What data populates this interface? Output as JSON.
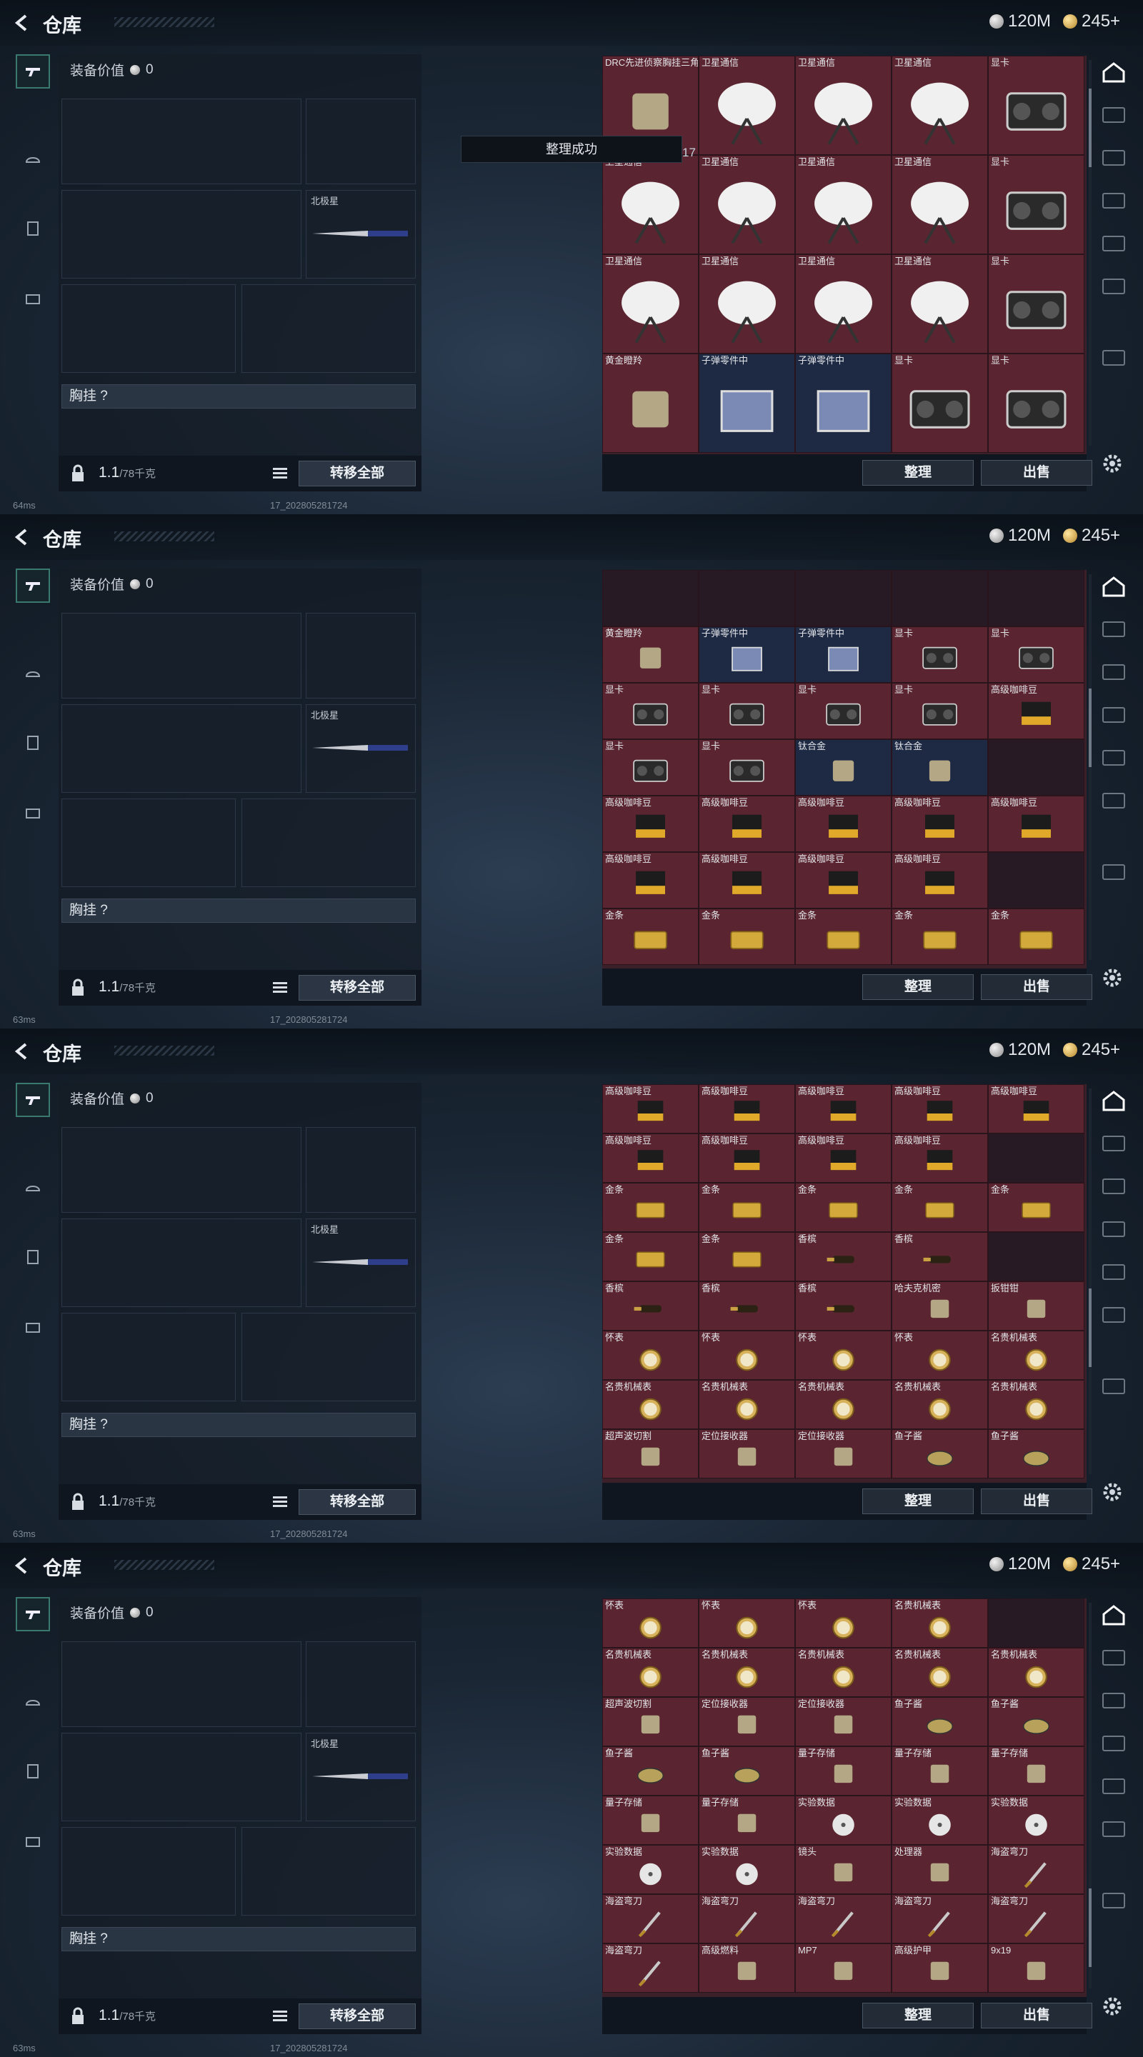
{
  "header": {
    "title": "仓库",
    "silver": "120M",
    "gold": "245+"
  },
  "loadout": {
    "equipment_value_label": "装备价值",
    "equipment_value": "0",
    "melee_label": "北极星",
    "chest_rig_label": "胸挂 ?",
    "weight": "1.1",
    "weight_max": "/78千克",
    "transfer_all": "转移全部"
  },
  "stash": {
    "sort_button": "整理",
    "sell_button": "出售"
  },
  "toast": {
    "message": "整理成功",
    "count": "17"
  },
  "panels": [
    {
      "ping": "64ms",
      "build": "17_2028052817​24",
      "rows": [
        [
          "DRC先进侦察胸挂三角洲",
          "卫星通信",
          "卫星通信",
          "卫星通信",
          "显卡"
        ],
        [
          "卫星通信",
          "卫星通信",
          "卫星通信",
          "卫星通信",
          "显卡"
        ],
        [
          "卫星通信",
          "卫星通信",
          "卫星通信",
          "卫星通信",
          "显卡"
        ],
        [
          "黄金瞪羚",
          "子弹零件中",
          "子弹零件中",
          "显卡",
          "显卡"
        ]
      ]
    },
    {
      "ping": "63ms",
      "build": "17_20280528172​4",
      "rows": [
        [
          "",
          "",
          "",
          "",
          ""
        ],
        [
          "黄金瞪羚",
          "子弹零件中",
          "子弹零件中",
          "显卡",
          "显卡"
        ],
        [
          "显卡",
          "显卡",
          "显卡",
          "显卡",
          "高级咖啡豆"
        ],
        [
          "显卡",
          "显卡",
          "钛合金",
          "钛合金",
          ""
        ],
        [
          "高级咖啡豆",
          "高级咖啡豆",
          "高级咖啡豆",
          "高级咖啡豆",
          "高级咖啡豆"
        ],
        [
          "高级咖啡豆",
          "高级咖啡豆",
          "高级咖啡豆",
          "高级咖啡豆",
          ""
        ],
        [
          "金条",
          "金条",
          "金条",
          "金条",
          "金条"
        ]
      ]
    },
    {
      "ping": "63ms",
      "build": "17_2028052817​24",
      "rows": [
        [
          "高级咖啡豆",
          "高级咖啡豆",
          "高级咖啡豆",
          "高级咖啡豆",
          "高级咖啡豆"
        ],
        [
          "高级咖啡豆",
          "高级咖啡豆",
          "高级咖啡豆",
          "高级咖啡豆",
          ""
        ],
        [
          "金条",
          "金条",
          "金条",
          "金条",
          "金条"
        ],
        [
          "金条",
          "金条",
          "香槟",
          "香槟",
          ""
        ],
        [
          "香槟",
          "香槟",
          "香槟",
          "哈夫克机密",
          "扳钳钳"
        ],
        [
          "怀表",
          "怀表",
          "怀表",
          "怀表",
          "名贵机械表"
        ],
        [
          "名贵机械表",
          "名贵机械表",
          "名贵机械表",
          "名贵机械表",
          "名贵机械表"
        ],
        [
          "超声波切割",
          "定位接收器",
          "定位接收器",
          "鱼子酱",
          "鱼子酱"
        ]
      ]
    },
    {
      "ping": "63ms",
      "build": "17_2028052817​24",
      "rows": [
        [
          "怀表",
          "怀表",
          "怀表",
          "名贵机械表",
          ""
        ],
        [
          "名贵机械表",
          "名贵机械表",
          "名贵机械表",
          "名贵机械表",
          "名贵机械表"
        ],
        [
          "超声波切割",
          "定位接收器",
          "定位接收器",
          "鱼子酱",
          "鱼子酱"
        ],
        [
          "鱼子酱",
          "鱼子酱",
          "量子存储",
          "量子存储",
          "量子存储"
        ],
        [
          "量子存储",
          "量子存储",
          "实验数据",
          "实验数据",
          "实验数据"
        ],
        [
          "实验数据",
          "实验数据",
          "镜头",
          "处理器",
          "海盗弯刀"
        ],
        [
          "海盗弯刀",
          "海盗弯刀",
          "海盗弯刀",
          "海盗弯刀",
          "海盗弯刀"
        ],
        [
          "海盗弯刀",
          "高级燃料",
          "MP7",
          "高级护甲",
          "9x19"
        ]
      ]
    }
  ]
}
